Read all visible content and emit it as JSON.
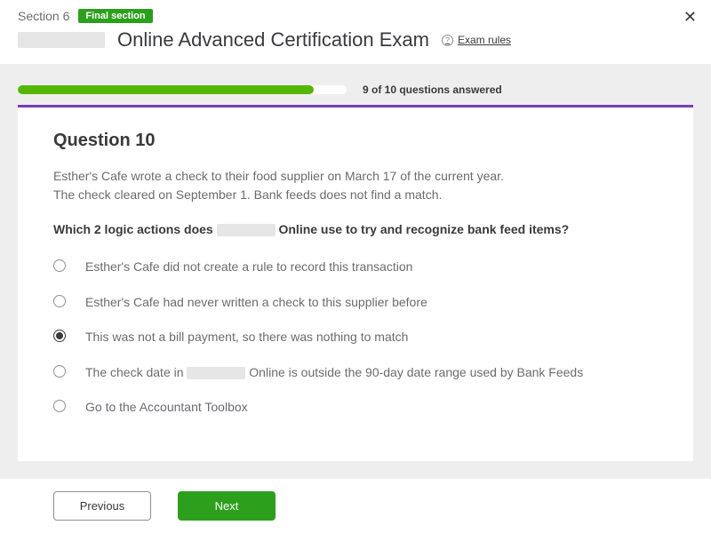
{
  "header": {
    "section_label": "Section 6",
    "badge": "Final section",
    "title_suffix": "Online Advanced Certification Exam",
    "rules_link": "Exam rules"
  },
  "progress": {
    "answered": 9,
    "total": 10,
    "text": "9 of 10 questions answered",
    "percent": 90
  },
  "question": {
    "title": "Question 10",
    "context_line1": "Esther's Cafe wrote a check to their food supplier on March 17 of the current year.",
    "context_line2": "The check cleared on September 1. Bank feeds does not find a match.",
    "prompt_prefix": "Which 2 logic actions does ",
    "prompt_suffix": " Online use to try and recognize bank feed items?",
    "options": [
      {
        "text": "Esther's Cafe did not create a rule to record this transaction",
        "selected": false
      },
      {
        "text": "Esther's Cafe had never written a check to this supplier before",
        "selected": false
      },
      {
        "text": "This was not a bill payment, so there was nothing to match",
        "selected": true
      },
      {
        "text_prefix": "The check date in ",
        "text_suffix": " Online is outside the 90-day date range used by Bank Feeds",
        "selected": false,
        "redacted": true
      },
      {
        "text": "Go to the Accountant Toolbox",
        "selected": false
      }
    ]
  },
  "footer": {
    "previous": "Previous",
    "next": "Next"
  }
}
